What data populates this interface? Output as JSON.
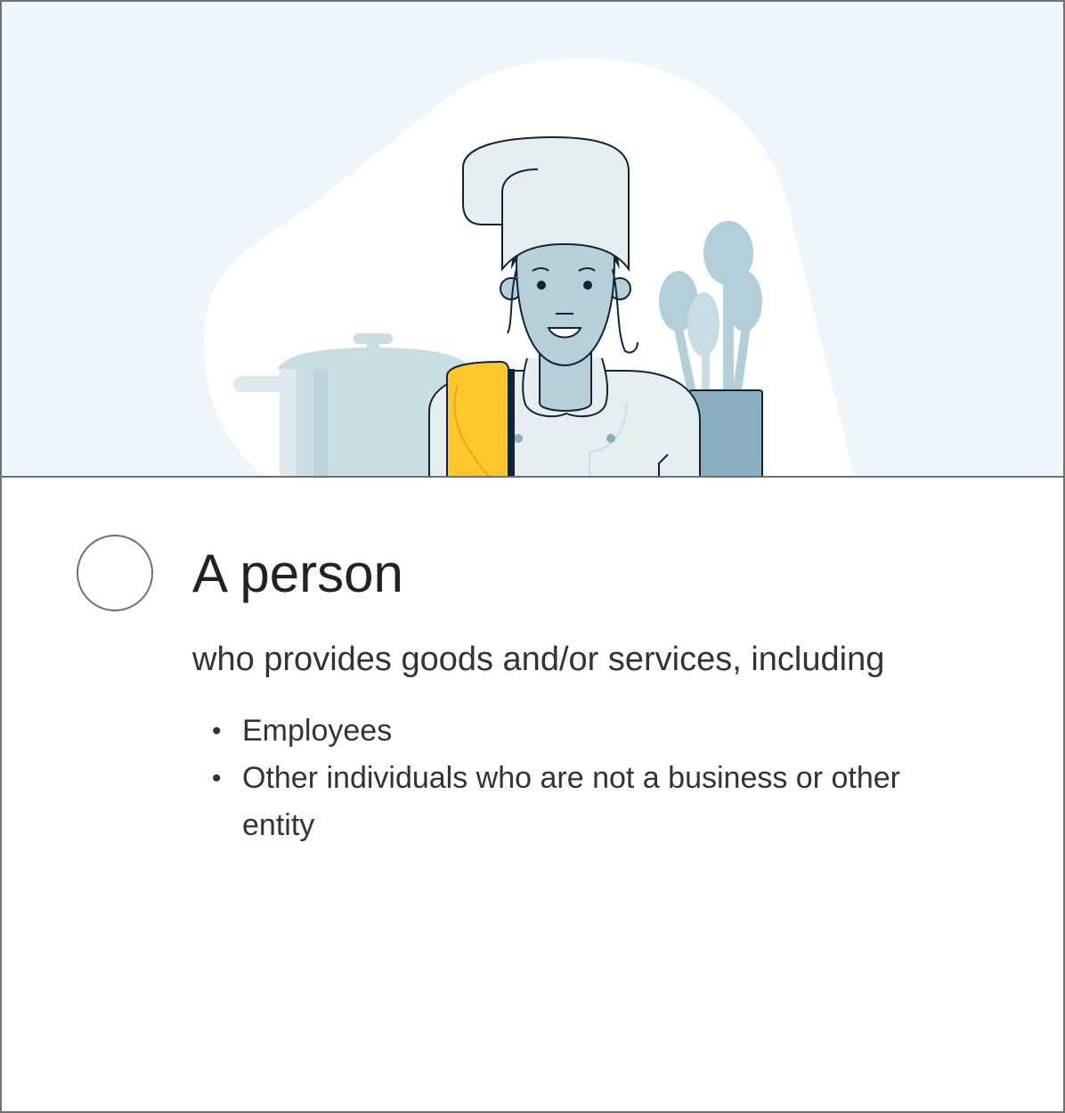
{
  "option": {
    "title": "A person",
    "subtitle": "who provides goods and/or services, including",
    "bullets": [
      "Employees",
      "Other individuals who are not a business or other entity"
    ],
    "bullet_glyph": "•",
    "selected": false
  },
  "illustration": {
    "subject": "chef-illustration",
    "colors": {
      "background": "#eef6fc",
      "blob": "#ffffff",
      "pot": "#c9dde5",
      "utensils": "#b2cfd9",
      "jar": "#8aaebf",
      "skin": "#b7cfd9",
      "towel": "#ffc72c",
      "outline": "#0f2438"
    }
  }
}
